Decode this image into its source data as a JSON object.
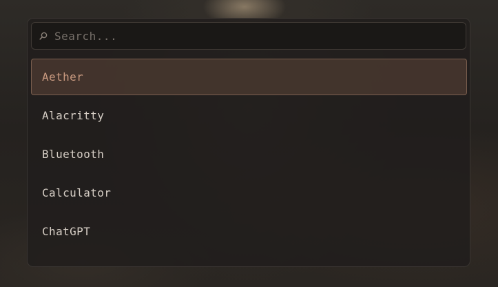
{
  "search": {
    "placeholder": "Search...",
    "value": "",
    "icon": "search-icon"
  },
  "results": [
    {
      "label": "Aether",
      "selected": true
    },
    {
      "label": "Alacritty",
      "selected": false
    },
    {
      "label": "Bluetooth",
      "selected": false
    },
    {
      "label": "Calculator",
      "selected": false
    },
    {
      "label": "ChatGPT",
      "selected": false
    }
  ],
  "colors": {
    "selected_text": "#c99a80",
    "selected_background": "#5c4638",
    "text": "#d7cfc6",
    "placeholder": "#77706a"
  }
}
